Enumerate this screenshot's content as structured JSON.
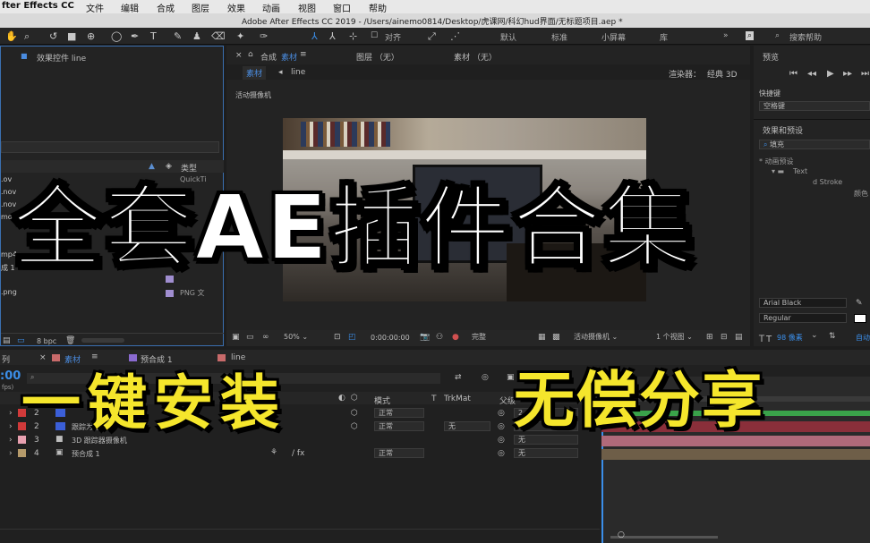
{
  "menubar": {
    "app": "fter Effects CC",
    "items": [
      "文件",
      "编辑",
      "合成",
      "图层",
      "效果",
      "动画",
      "视图",
      "窗口",
      "帮助"
    ]
  },
  "titlebar": {
    "text": "Adobe After Effects CC 2019 - /Users/ainemo0814/Desktop/虎课网/科幻hud界面/无标题项目.aep *"
  },
  "toolbar": {
    "align_label": "对齐",
    "workspaces": [
      "默认",
      "标准",
      "小屏幕",
      "库"
    ],
    "search_placeholder": "搜索帮助"
  },
  "left_panel": {
    "title": "效果控件 line",
    "column_type": "类型",
    "files": [
      ".ov",
      ".nov",
      ".nov",
      "mov",
      "mp4",
      "成 1",
      ".png"
    ],
    "types": [
      "QuickTi",
      "",
      "",
      "",
      "",
      "",
      "PNG 文"
    ],
    "bpc": "8 bpc"
  },
  "comp_panel": {
    "tab_comp_prefix": "合成",
    "tab_comp": "素材",
    "tab_layer": "图层 （无）",
    "tab_footage": "素材 （无）",
    "sub_tab_active": "素材",
    "sub_tab_2": "line",
    "renderer_label": "渲染器：",
    "renderer": "经典 3D",
    "camera_label": "活动摄像机",
    "bottom": {
      "zoom": "50%",
      "timecode": "0:00:00:00",
      "quality": "完整",
      "camera": "活动摄像机",
      "views": "1 个视图"
    }
  },
  "right_panel": {
    "preview_title": "预览",
    "shortcut_label": "快捷键",
    "shortcut_value": "空格键",
    "effects_title": "效果和预设",
    "search_value": "填充",
    "tree_1": "* 动画预设",
    "tree_2": "Text",
    "tree_3": "d Stroke",
    "tree_4": "颜色",
    "font_name": "Arial Black",
    "font_style": "Regular",
    "font_size": "98 像素",
    "auto_label": "自动"
  },
  "timeline": {
    "tabs": [
      "列",
      "素材",
      "预合成 1",
      "line"
    ],
    "timecode_part": ":00",
    "fps": "fps)",
    "col_mode": "模式",
    "col_t": "T",
    "col_trkmat": "TrkMat",
    "col_parent": "父级",
    "layers": [
      {
        "num": "2",
        "name": "跟踪为空 1",
        "color": "#d13a3a",
        "mode": "正常",
        "trkmat": "",
        "parent": "2. 跟"
      },
      {
        "num": "2",
        "name": "跟踪为空",
        "color": "#3b5fd8",
        "mode": "正常",
        "trkmat": "无",
        "parent": "无"
      },
      {
        "num": "3",
        "name": "3D 跟踪器摄像机",
        "color": "#e8a0b0",
        "mode": "",
        "trkmat": "",
        "parent": "无"
      },
      {
        "num": "4",
        "name": "预合成 1",
        "color": "#b59a6a",
        "mode": "正常",
        "trkmat": "",
        "parent": "无"
      }
    ]
  },
  "overlay": {
    "title": "全套AE插件合集",
    "left_text": "一键安装",
    "right_text": "无偿分享"
  },
  "colors": {
    "accent": "#3b8ee8",
    "overlay_yellow": "#f5e62c",
    "overlay_white": "#ffffff"
  }
}
